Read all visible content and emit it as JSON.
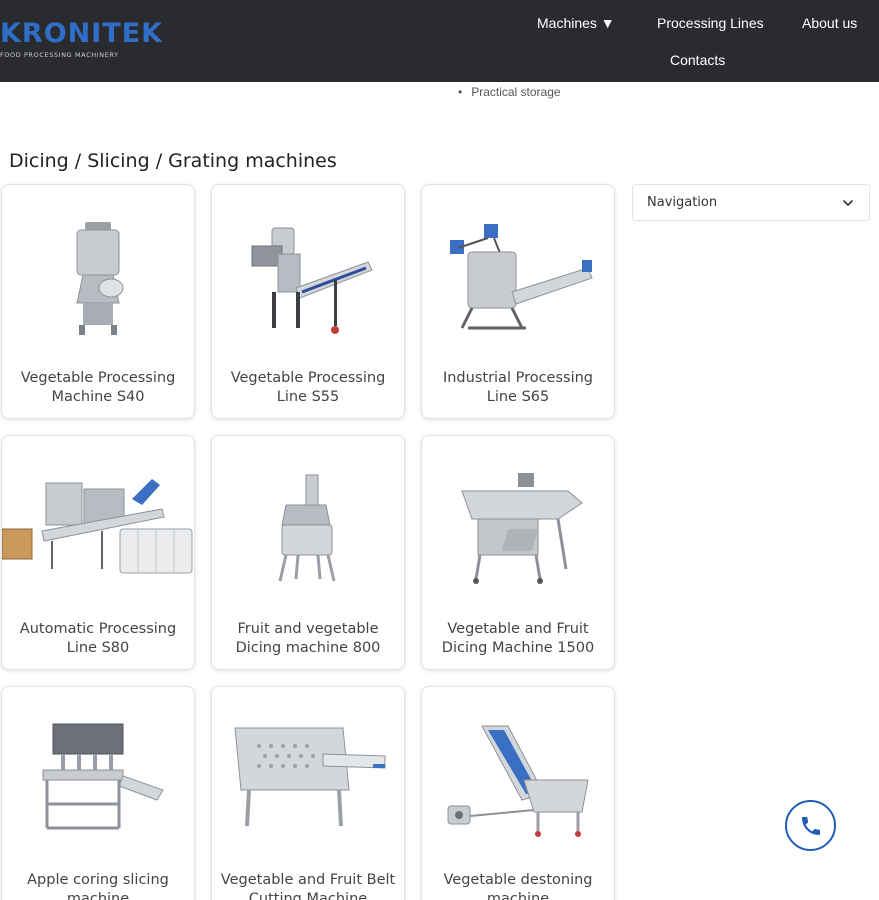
{
  "header": {
    "logo_text": "KRONITEK",
    "logo_subtitle": "FOOD PROCESSING MACHINERY",
    "nav": {
      "machines": "Machines ▼",
      "processing_lines": "Processing Lines",
      "about": "About us",
      "contacts": "Contacts"
    }
  },
  "features": {
    "bullet": "Practical storage"
  },
  "section": {
    "title": "Dicing / Slicing / Grating machines"
  },
  "sidebar": {
    "navigation_label": "Navigation"
  },
  "products": [
    {
      "title": "Vegetable Processing Machine S40"
    },
    {
      "title": "Vegetable Processing Line S55"
    },
    {
      "title": "Industrial Processing Line S65"
    },
    {
      "title": "Automatic Processing Line S80"
    },
    {
      "title": "Fruit and vegetable Dicing machine 800"
    },
    {
      "title": "Vegetable and Fruit Dicing Machine 1500"
    },
    {
      "title": "Apple coring slicing machine"
    },
    {
      "title": "Vegetable and Fruit Belt Cutting Machine"
    },
    {
      "title": "Vegetable destoning machine"
    }
  ],
  "colors": {
    "header_bg": "#2a2b2f",
    "brand_blue": "#2f6fc7",
    "phone_blue": "#1f5db8"
  },
  "icons": {
    "navigation_toggle": "chevron-down-icon",
    "call": "phone-icon"
  }
}
